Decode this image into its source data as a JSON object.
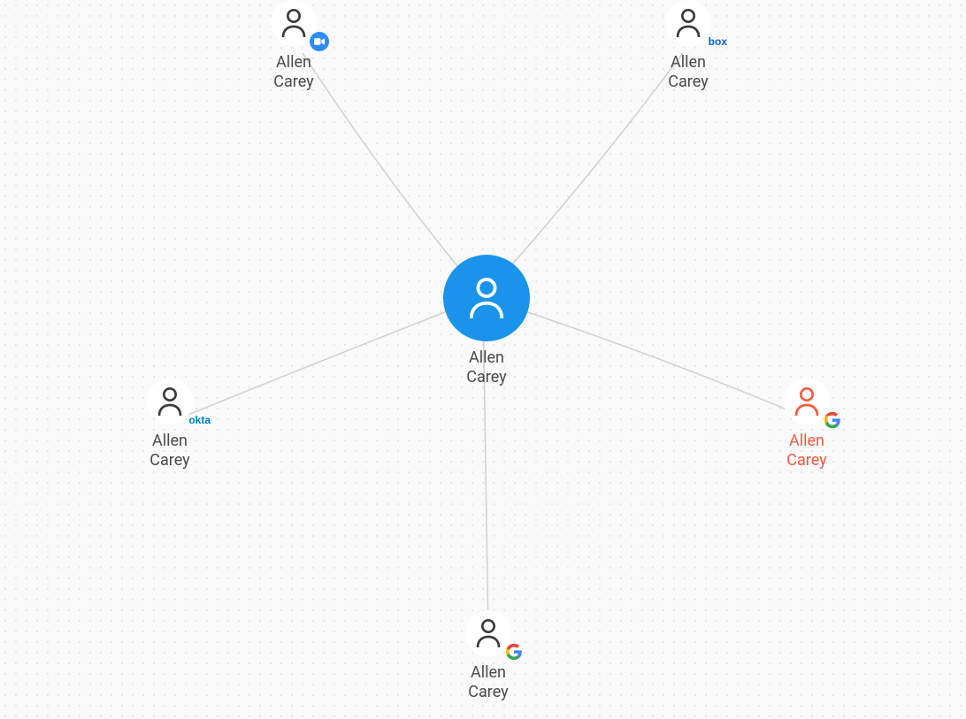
{
  "center": {
    "name_line1": "Allen",
    "name_line2": "Carey"
  },
  "nodes": {
    "zoom": {
      "name_line1": "Allen",
      "name_line2": "Carey",
      "provider": "zoom"
    },
    "box": {
      "name_line1": "Allen",
      "name_line2": "Carey",
      "provider": "box",
      "provider_label": "box"
    },
    "okta": {
      "name_line1": "Allen",
      "name_line2": "Carey",
      "provider": "okta",
      "provider_label": "okta"
    },
    "google_red": {
      "name_line1": "Allen",
      "name_line2": "Carey",
      "provider": "google",
      "highlight": true
    },
    "google_bottom": {
      "name_line1": "Allen",
      "name_line2": "Carey",
      "provider": "google"
    }
  }
}
